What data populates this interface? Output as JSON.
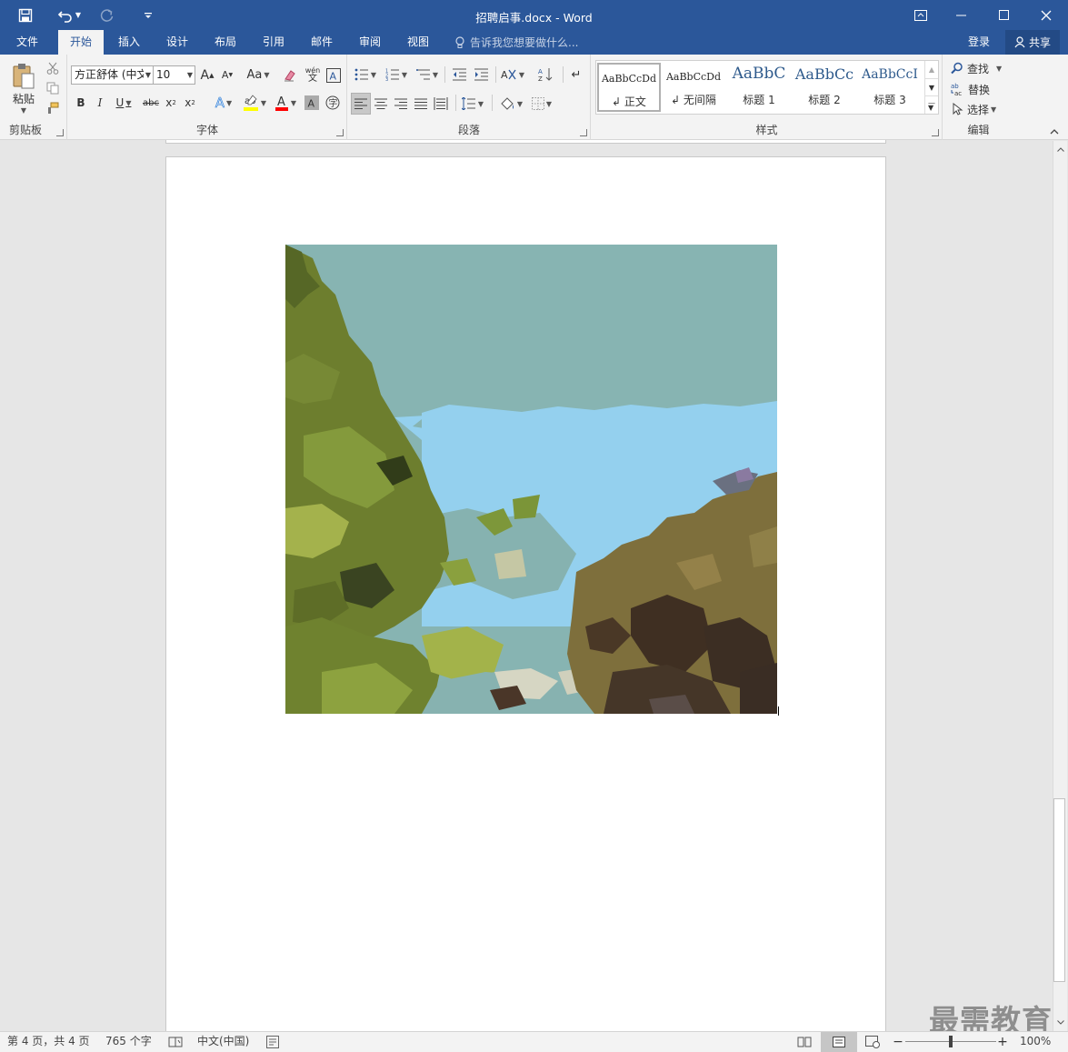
{
  "window": {
    "title": "招聘启事.docx - Word"
  },
  "tabs": [
    {
      "label": "文件"
    },
    {
      "label": "开始"
    },
    {
      "label": "插入"
    },
    {
      "label": "设计"
    },
    {
      "label": "布局"
    },
    {
      "label": "引用"
    },
    {
      "label": "邮件"
    },
    {
      "label": "审阅"
    },
    {
      "label": "视图"
    }
  ],
  "tell_me": {
    "placeholder": "告诉我您想要做什么..."
  },
  "account": {
    "login": "登录",
    "share": "共享"
  },
  "clipboard": {
    "paste": "粘贴",
    "label": "剪贴板"
  },
  "font": {
    "name": "方正舒体 (中文",
    "size": "10",
    "label": "字体",
    "change_case": "Aa"
  },
  "paragraph": {
    "label": "段落"
  },
  "styles": {
    "label": "样式",
    "items": [
      {
        "sample": "AaBbCcDd",
        "name": "正文"
      },
      {
        "sample": "AaBbCcDd",
        "name": "无间隔"
      },
      {
        "sample": "AaBbC",
        "name": "标题 1"
      },
      {
        "sample": "AaBbCc",
        "name": "标题 2"
      },
      {
        "sample": "AaBbCcI",
        "name": "标题 3"
      }
    ]
  },
  "editing": {
    "find": "查找",
    "replace": "替换",
    "select": "选择",
    "label": "编辑"
  },
  "status": {
    "page": "第 4 页，共 4 页",
    "words": "765 个字",
    "language": "中文(中国)",
    "zoom": "100%",
    "zoom_level": 1.0
  },
  "watermark": "最需教育",
  "colors": {
    "brand": "#2b579a",
    "highlight": "#ffff00",
    "font_color": "#ff0000"
  }
}
